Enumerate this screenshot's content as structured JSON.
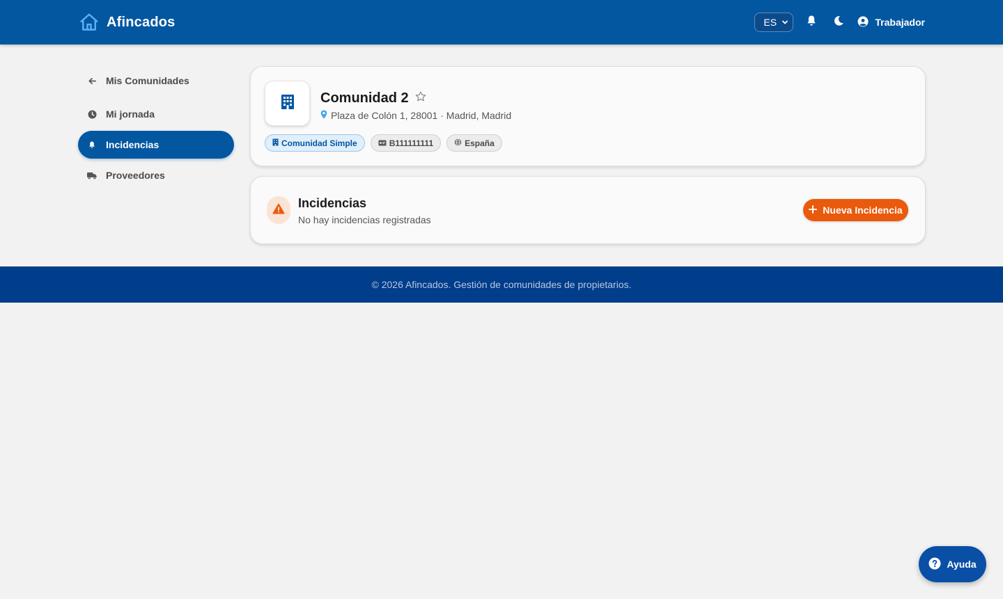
{
  "header": {
    "brand": "Afincados",
    "language": "ES",
    "user": "Trabajador"
  },
  "sidebar": {
    "items": [
      {
        "label": "Mis Comunidades",
        "icon": "arrow-left-icon"
      },
      {
        "label": "Mi jornada",
        "icon": "clock-icon"
      },
      {
        "label": "Incidencias",
        "icon": "bell-icon",
        "active": true
      },
      {
        "label": "Proveedores",
        "icon": "truck-icon"
      }
    ]
  },
  "community": {
    "name": "Comunidad 2",
    "address": "Plaza de Colón 1, 28001 · Madrid, Madrid",
    "chips": [
      {
        "label": "Comunidad Simple",
        "icon": "building-icon"
      },
      {
        "label": "B111111111",
        "icon": "id-card-icon"
      },
      {
        "label": "España",
        "icon": "globe-icon"
      }
    ]
  },
  "incidents": {
    "title": "Incidencias",
    "subtitle": "No hay incidencias registradas",
    "new_button": "Nueva Incidencia"
  },
  "footer": {
    "text": "© 2026 Afincados. Gestión de comunidades de propietarios."
  },
  "help": {
    "label": "Ayuda"
  },
  "colors": {
    "primary": "#0357a1",
    "footer": "#003d8a",
    "accent": "#e95a0c",
    "background": "#f2f2f2"
  }
}
